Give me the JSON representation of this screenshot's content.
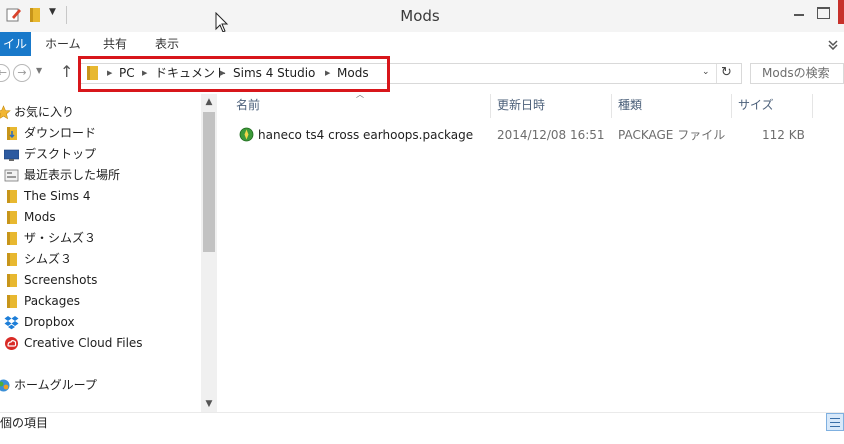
{
  "window": {
    "title": "Mods"
  },
  "ribbon": {
    "tabs": [
      "イル",
      "ホーム",
      "共有",
      "表示"
    ]
  },
  "address": {
    "path": [
      "PC",
      "ドキュメント",
      "Sims 4 Studio",
      "Mods"
    ],
    "search_placeholder": "Modsの検索"
  },
  "nav": {
    "items": [
      {
        "label": "お気に入り",
        "icon": "star-icon"
      },
      {
        "label": "ダウンロード",
        "icon": "download-folder-icon"
      },
      {
        "label": "デスクトップ",
        "icon": "desktop-icon"
      },
      {
        "label": "最近表示した場所",
        "icon": "recent-places-icon"
      },
      {
        "label": "The Sims 4",
        "icon": "folder-icon"
      },
      {
        "label": "Mods",
        "icon": "folder-icon"
      },
      {
        "label": "ザ・シムズ３",
        "icon": "folder-icon"
      },
      {
        "label": "シムズ３",
        "icon": "folder-icon"
      },
      {
        "label": "Screenshots",
        "icon": "folder-icon"
      },
      {
        "label": "Packages",
        "icon": "folder-icon"
      },
      {
        "label": "Dropbox",
        "icon": "dropbox-icon"
      },
      {
        "label": "Creative Cloud Files",
        "icon": "creative-cloud-icon"
      },
      {
        "label": "ホームグループ",
        "icon": "homegroup-icon"
      }
    ]
  },
  "columns": {
    "name": "名前",
    "date": "更新日時",
    "type": "種類",
    "size": "サイズ"
  },
  "files": [
    {
      "name": "haneco ts4 cross earhoops.package",
      "date": "2014/12/08 16:51",
      "type": "PACKAGE ファイル",
      "size": "112 KB"
    }
  ],
  "status": {
    "count_text": "個の項目"
  },
  "colors": {
    "accent": "#1979ca",
    "highlight": "#d8161b",
    "folder": "#e8b830"
  }
}
